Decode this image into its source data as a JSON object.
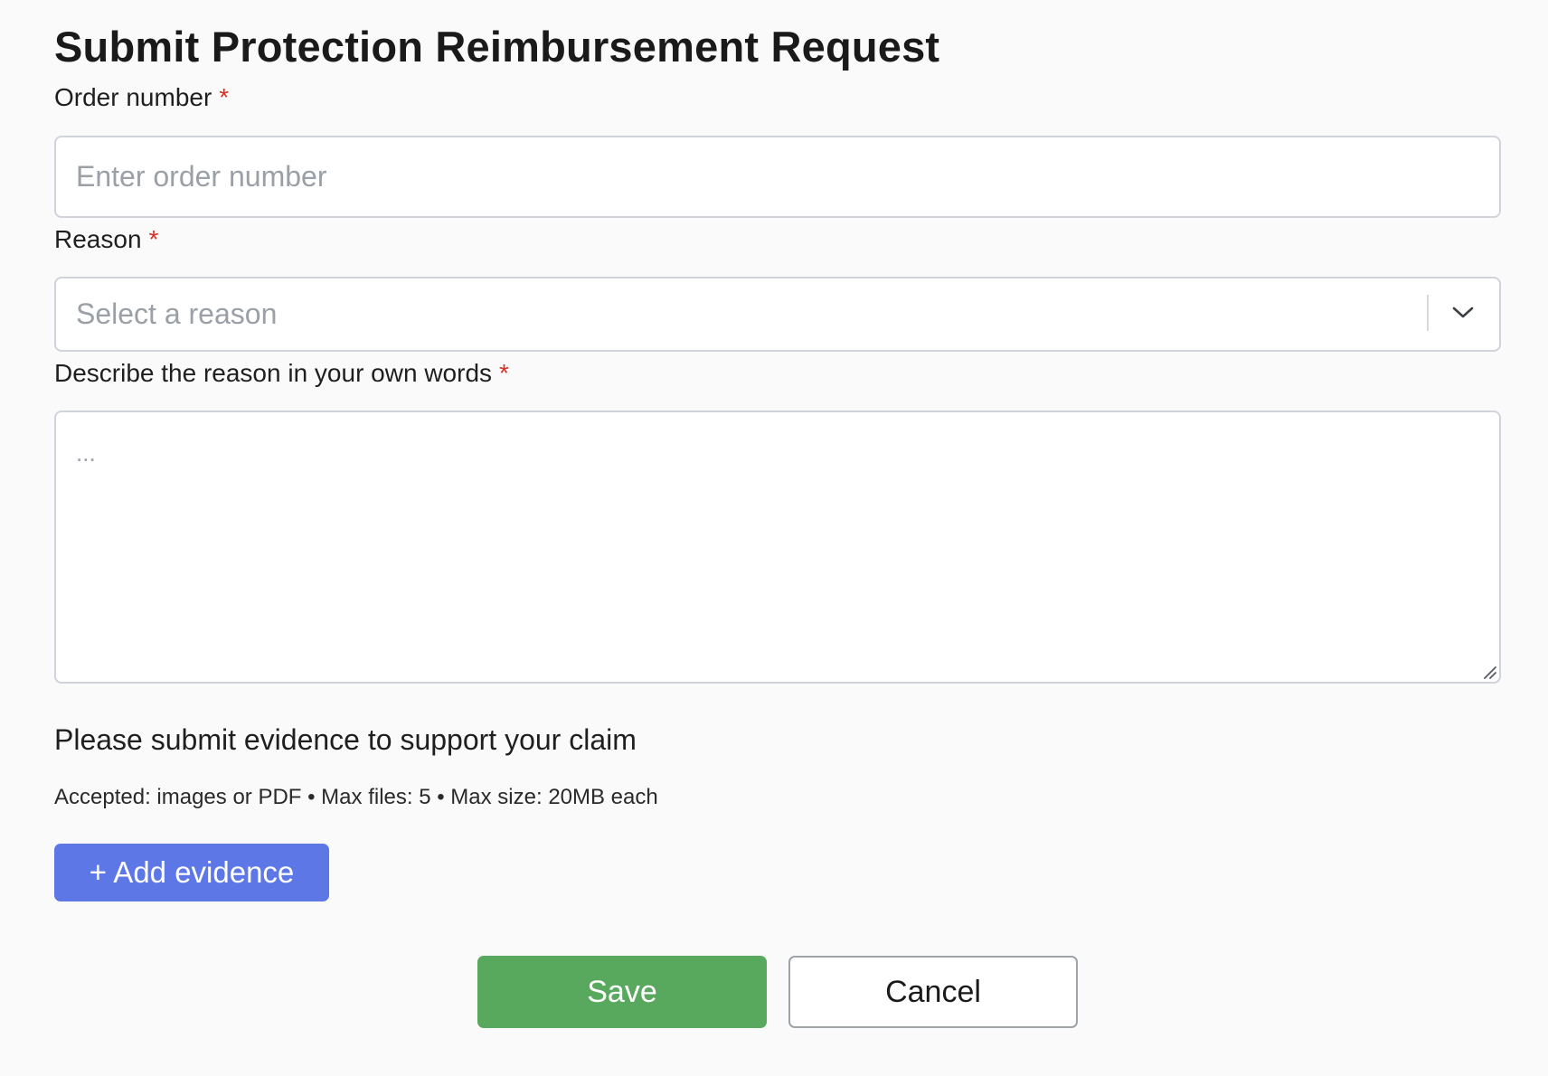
{
  "form": {
    "title": "Submit Protection Reimbursement Request",
    "required_marker": "*",
    "order_number": {
      "label": "Order number",
      "placeholder": "Enter order number",
      "value": ""
    },
    "reason": {
      "label": "Reason",
      "placeholder": "Select a reason",
      "selected": ""
    },
    "description": {
      "label": "Describe the reason in your own words",
      "placeholder": "...",
      "value": ""
    },
    "evidence": {
      "heading": "Please submit evidence to support your claim",
      "note": "Accepted: images or PDF • Max files: 5 • Max size: 20MB each",
      "add_button": "+ Add evidence"
    },
    "actions": {
      "save": "Save",
      "cancel": "Cancel"
    }
  },
  "colors": {
    "required": "#d93025",
    "primary": "#5d77e6",
    "save": "#58a85e",
    "background": "#fafafa"
  },
  "icons": {
    "select_toggle": "chevron-down-icon",
    "textarea_resize": "resize-handle-icon"
  }
}
